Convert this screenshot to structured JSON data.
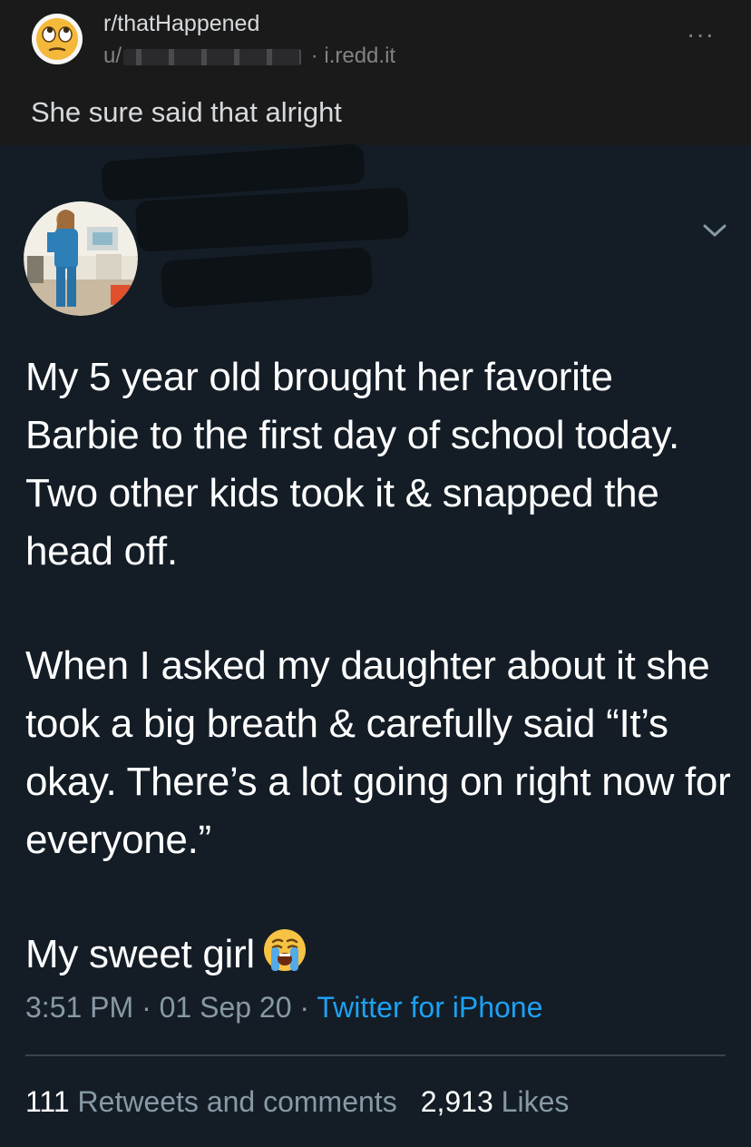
{
  "header": {
    "subreddit": "r/thatHappened",
    "username_prefix": "u/",
    "separator": "·",
    "domain": "i.redd.it",
    "more_label": "···",
    "post_title": "She sure said that alright"
  },
  "tweet": {
    "paragraphs": [
      "My 5 year old brought her favorite Barbie to the first day of school today. Two other kids took it & snapped the head off.",
      "When I asked my daughter about it she took a big breath & carefully said “It’s okay. There’s a lot going on right now for everyone.”",
      "My sweet girl"
    ],
    "time": "3:51 PM",
    "dot": "·",
    "date": "01 Sep 20",
    "source": "Twitter for iPhone",
    "retweets_count": "111",
    "retweets_label": "Retweets and comments",
    "likes_count": "2,913",
    "likes_label": "Likes"
  },
  "icons": {
    "subreddit_icon": "eye-roll-emoji-icon",
    "avatar": "profile-photo",
    "chevron": "chevron-down-icon",
    "emoji": "crying-face-emoji-icon"
  },
  "colors": {
    "reddit_bg": "#1a1a1b",
    "tweet_bg": "#141d26",
    "link_blue": "#1da1f2",
    "meta_gray": "#8899a6"
  }
}
